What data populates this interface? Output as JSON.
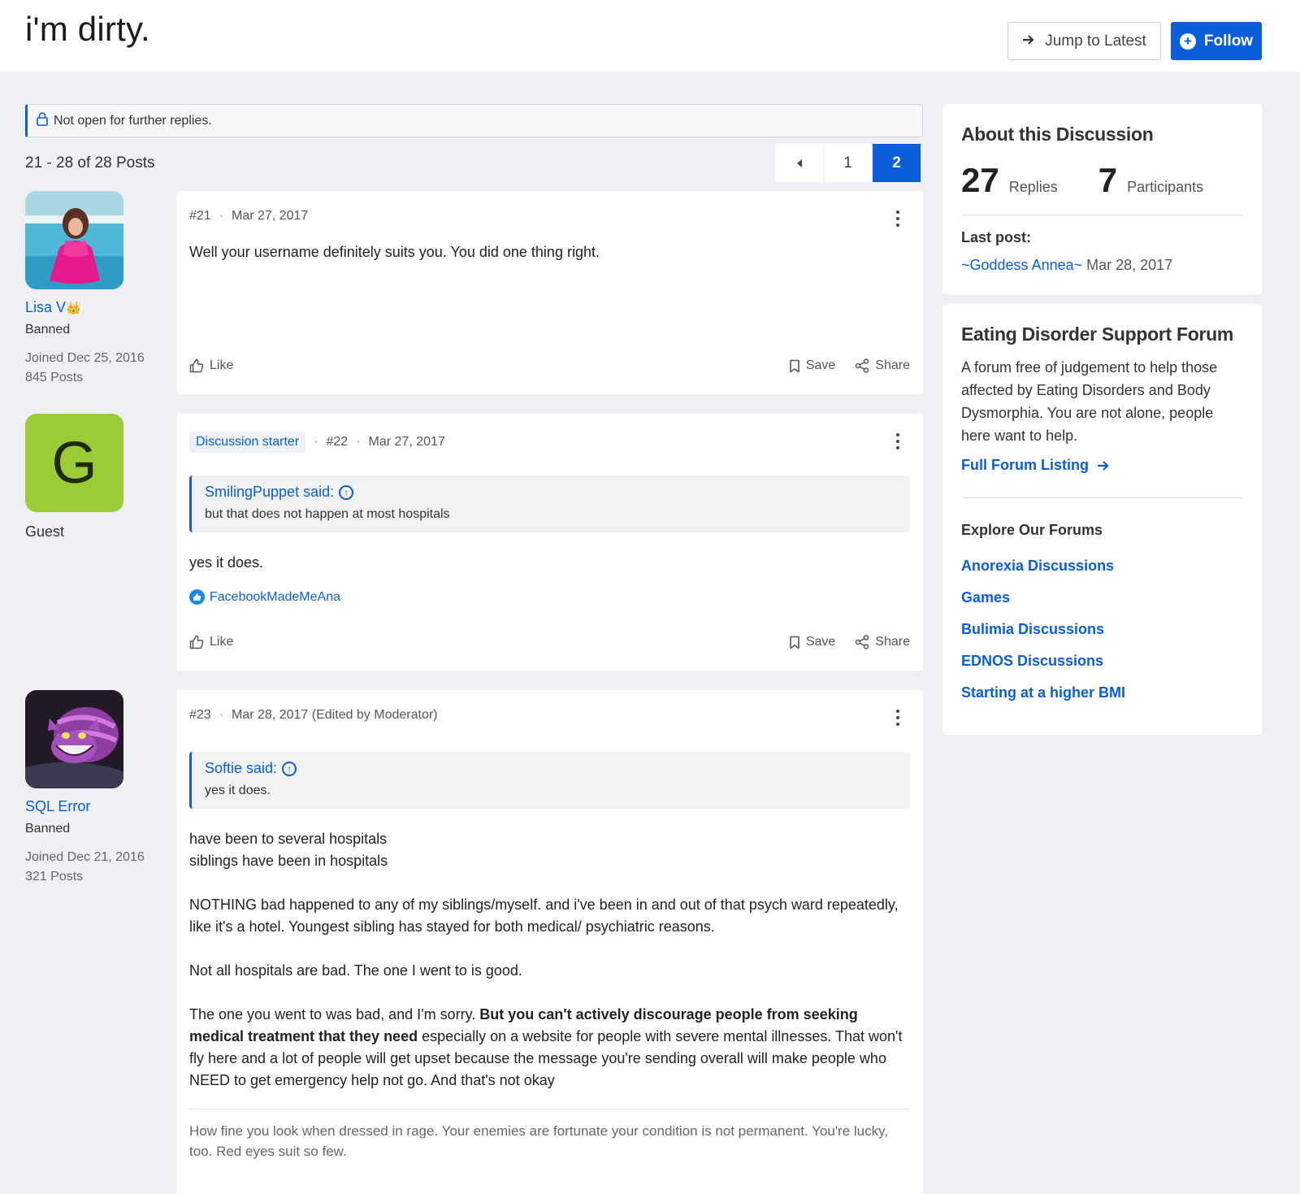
{
  "header": {
    "title": "i'm dirty.",
    "jump_label": "Jump to Latest",
    "follow_label": "Follow"
  },
  "notice": {
    "text": "Not open for further replies."
  },
  "pagination": {
    "summary": "21 - 28 of 28 Posts",
    "pages": [
      "1",
      "2"
    ],
    "current": "2"
  },
  "posts": [
    {
      "author": {
        "name": "Lisa V",
        "role": "Banned",
        "joined": "Joined Dec 25, 2016",
        "posts": "845 Posts"
      },
      "number": "#21",
      "date": "Mar 27, 2017",
      "body": "Well your username definitely suits you. You did one thing right.",
      "like": "Like",
      "save": "Save",
      "share": "Share"
    },
    {
      "author": {
        "name": "Guest",
        "initial": "G"
      },
      "badge": "Discussion starter",
      "number": "#22",
      "date": "Mar 27, 2017",
      "quote": {
        "author": "SmilingPuppet said:",
        "text": "but that does not happen at most hospitals"
      },
      "body": "yes it does.",
      "reaction_user": "FacebookMadeMeAna",
      "like": "Like",
      "save": "Save",
      "share": "Share"
    },
    {
      "author": {
        "name": "SQL Error",
        "role": "Banned",
        "joined": "Joined Dec 21, 2016",
        "posts": "321 Posts"
      },
      "number": "#23",
      "date": "Mar 28, 2017 (Edited by Moderator)",
      "quote": {
        "author": "Softie said:",
        "text": "yes it does."
      },
      "body_p1_l1": "have been to several hospitals",
      "body_p1_l2": "siblings have been in hospitals",
      "body_p2": "NOTHING bad happened to any of my siblings/myself. and i've been in and out of that psych ward repeatedly, like it's a hotel. Youngest sibling has stayed for both medical/ psychiatric reasons.",
      "body_p3": "Not all hospitals are bad. The one I went to is good.",
      "body_p4_a": "The one you went to was bad, and I'm sorry. ",
      "body_p4_bold": "But you can't actively discourage people from seeking medical treatment that they need",
      "body_p4_b": " especially on a website for people with severe mental illnesses. That won't fly here and a lot of people will get upset because the message you're sending overall will make people who NEED to get emergency help not go. And that's not okay",
      "signature": "How fine you look when dressed in rage. Your enemies are fortunate your condition is not permanent. You're lucky, too. Red eyes suit so few."
    }
  ],
  "sidebar": {
    "about": {
      "title": "About this Discussion",
      "replies_count": "27",
      "replies_label": "Replies",
      "participants_count": "7",
      "participants_label": "Participants",
      "last_post_label": "Last post:",
      "last_post_user": "~Goddess Annea~",
      "last_post_date": "Mar 28, 2017"
    },
    "forum": {
      "title": "Eating Disorder Support Forum",
      "description": "A forum free of judgement to help those affected by Eating Disorders and Body Dysmorphia. You are not alone, people here want to help.",
      "full_listing": "Full Forum Listing",
      "explore_title": "Explore Our Forums",
      "links": [
        "Anorexia Discussions",
        "Games",
        "Bulimia Discussions",
        "EDNOS Discussions",
        "Starting at a higher BMI"
      ]
    }
  },
  "colors": {
    "accent": "#0b5ed7",
    "background": "#eef0f3",
    "guest_avatar": "#9bcb36"
  }
}
